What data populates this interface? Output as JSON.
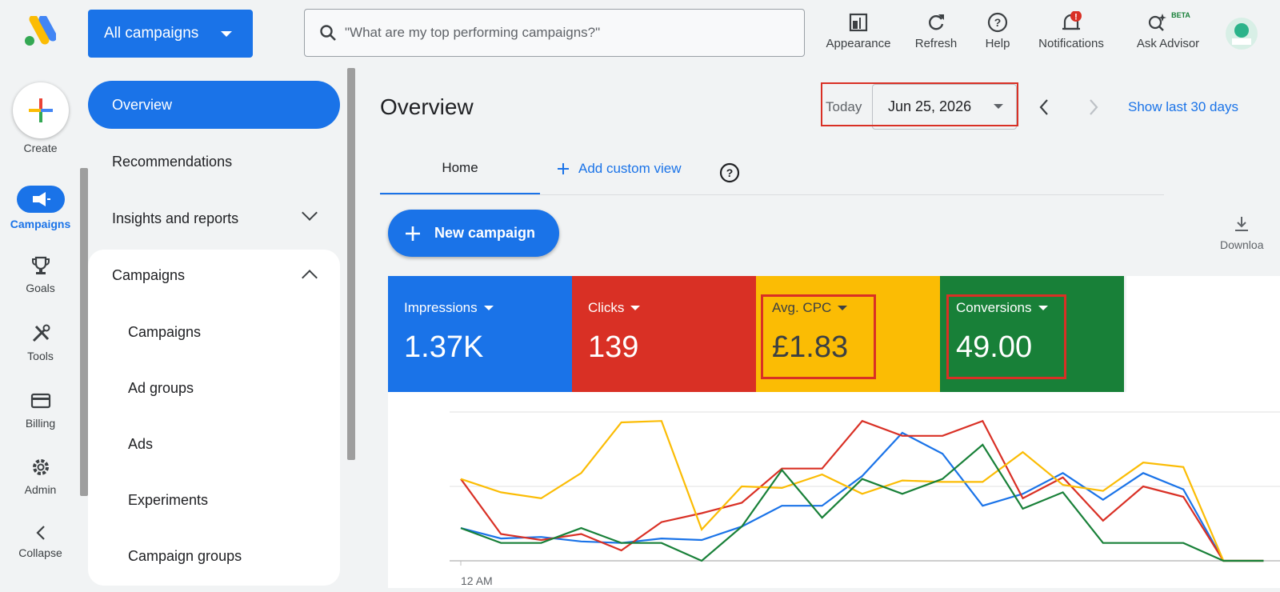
{
  "header": {
    "account_selector": "All campaigns",
    "search_placeholder": "\"What are my top performing campaigns?\"",
    "tools": [
      {
        "label": "Appearance",
        "icon": "appearance-icon"
      },
      {
        "label": "Refresh",
        "icon": "refresh-icon"
      },
      {
        "label": "Help",
        "icon": "help-icon"
      },
      {
        "label": "Notifications",
        "icon": "notifications-icon",
        "badge": "!"
      },
      {
        "label": "Ask Advisor",
        "icon": "ask-advisor-icon",
        "tag": "BETA"
      }
    ]
  },
  "rail": {
    "items": [
      {
        "label": "Create",
        "icon": "plus-icon"
      },
      {
        "label": "Campaigns",
        "icon": "megaphone-icon",
        "active": true
      },
      {
        "label": "Goals",
        "icon": "trophy-icon"
      },
      {
        "label": "Tools",
        "icon": "tools-icon"
      },
      {
        "label": "Billing",
        "icon": "credit-card-icon"
      },
      {
        "label": "Admin",
        "icon": "gear-icon"
      },
      {
        "label": "Collapse",
        "icon": "chevron-left-icon"
      }
    ]
  },
  "nav": {
    "overview": "Overview",
    "recommendations": "Recommendations",
    "insights": "Insights and reports",
    "campaigns_section": "Campaigns",
    "sub_items": [
      "Campaigns",
      "Ad groups",
      "Ads",
      "Experiments",
      "Campaign groups"
    ]
  },
  "main": {
    "title": "Overview",
    "today_label": "Today",
    "date": "Jun 25, 2026",
    "show_last": "Show last 30 days",
    "tab_home": "Home",
    "add_custom_view": "Add custom view",
    "new_campaign": "New campaign",
    "download": "Downloa"
  },
  "metrics": [
    {
      "label": "Impressions",
      "value": "1.37K",
      "color": "#1a73e8"
    },
    {
      "label": "Clicks",
      "value": "139",
      "color": "#d93025"
    },
    {
      "label": "Avg. CPC",
      "value": "£1.83",
      "color": "#fbbc04"
    },
    {
      "label": "Conversions",
      "value": "49.00",
      "color": "#188038"
    }
  ],
  "chart_data": {
    "type": "line",
    "xlabel": "",
    "ylabel": "",
    "x_tick_first": "12 AM",
    "x": [
      0,
      1,
      2,
      3,
      4,
      5,
      6,
      7,
      8,
      9,
      10,
      11,
      12,
      13,
      14,
      15,
      16,
      17,
      18,
      19,
      20
    ],
    "series": [
      {
        "color": "#1a73e8",
        "values": [
          0.22,
          0.15,
          0.16,
          0.13,
          0.12,
          0.15,
          0.14,
          0.23,
          0.37,
          0.37,
          0.57,
          0.86,
          0.72,
          0.37,
          0.45,
          0.59,
          0.41,
          0.59,
          0.48,
          0.0,
          0.0
        ]
      },
      {
        "color": "#d93025",
        "values": [
          0.55,
          0.18,
          0.14,
          0.18,
          0.07,
          0.26,
          0.32,
          0.39,
          0.62,
          0.62,
          0.94,
          0.84,
          0.84,
          0.94,
          0.42,
          0.56,
          0.27,
          0.5,
          0.43,
          0.0,
          0.0
        ]
      },
      {
        "color": "#fbbc04",
        "values": [
          0.55,
          0.46,
          0.42,
          0.59,
          0.93,
          0.94,
          0.21,
          0.5,
          0.49,
          0.58,
          0.45,
          0.54,
          0.53,
          0.53,
          0.73,
          0.51,
          0.47,
          0.66,
          0.63,
          0.0,
          0.0
        ]
      },
      {
        "color": "#188038",
        "values": [
          0.22,
          0.12,
          0.12,
          0.22,
          0.12,
          0.12,
          0.0,
          0.23,
          0.61,
          0.29,
          0.55,
          0.45,
          0.55,
          0.78,
          0.35,
          0.46,
          0.12,
          0.12,
          0.12,
          0.0,
          0.0
        ]
      }
    ]
  }
}
